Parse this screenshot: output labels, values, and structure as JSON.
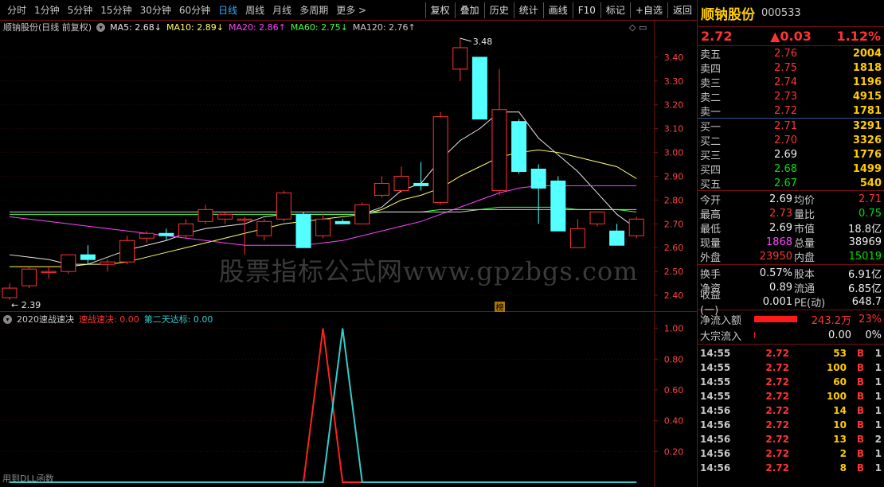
{
  "toolbar": {
    "periods": [
      "分时",
      "1分钟",
      "5分钟",
      "15分钟",
      "30分钟",
      "60分钟",
      "日线",
      "周线",
      "月线",
      "多周期",
      "更多 >"
    ],
    "active_period": "日线",
    "buttons": [
      "复权",
      "叠加",
      "历史",
      "统计",
      "画线",
      "F10",
      "标记",
      "+自选",
      "返回"
    ]
  },
  "main_chart": {
    "title": "顺钠股份(日线 前复权)",
    "ma_labels": [
      {
        "text": "MA5: 2.68↓",
        "color": "#e8e8e8"
      },
      {
        "text": "MA10: 2.89↓",
        "color": "#ffff66"
      },
      {
        "text": "MA20: 2.86↑",
        "color": "#ff44ff"
      },
      {
        "text": "MA60: 2.75↓",
        "color": "#44ff44"
      },
      {
        "text": "MA120: 2.76↑",
        "color": "#cccccc"
      }
    ],
    "high_label": "3.48",
    "low_label": "2.39",
    "marker_badge": "榜",
    "watermark": "股票指标公式网www.gpzbgs.com",
    "corner_icons": "◇ ▭"
  },
  "indicator_chart": {
    "name": "2020速战速决",
    "series_labels": [
      {
        "text": "速战速决: 0.00",
        "color": "#ff3333"
      },
      {
        "text": "第二天达标: 0.00",
        "color": "#33cccc"
      }
    ],
    "footer_note": "用到DLL函数"
  },
  "chart_data": [
    {
      "type": "candlestick",
      "title": "顺钠股份(日线 前复权)",
      "ylim": [
        2.35,
        3.52
      ],
      "y_ticks": [
        "3.40",
        "3.30",
        "3.20",
        "3.10",
        "3.00",
        "2.90",
        "2.80",
        "2.70",
        "2.60",
        "2.50",
        "2.40"
      ],
      "candles": [
        {
          "o": 2.39,
          "h": 2.45,
          "l": 2.38,
          "c": 2.43
        },
        {
          "o": 2.44,
          "h": 2.52,
          "l": 2.43,
          "c": 2.51
        },
        {
          "o": 2.5,
          "h": 2.52,
          "l": 2.47,
          "c": 2.5
        },
        {
          "o": 2.5,
          "h": 2.57,
          "l": 2.49,
          "c": 2.57
        },
        {
          "o": 2.57,
          "h": 2.61,
          "l": 2.53,
          "c": 2.55
        },
        {
          "o": 2.53,
          "h": 2.55,
          "l": 2.5,
          "c": 2.54
        },
        {
          "o": 2.54,
          "h": 2.65,
          "l": 2.53,
          "c": 2.63
        },
        {
          "o": 2.64,
          "h": 2.67,
          "l": 2.62,
          "c": 2.66
        },
        {
          "o": 2.66,
          "h": 2.68,
          "l": 2.63,
          "c": 2.65
        },
        {
          "o": 2.65,
          "h": 2.72,
          "l": 2.64,
          "c": 2.7
        },
        {
          "o": 2.71,
          "h": 2.78,
          "l": 2.7,
          "c": 2.76
        },
        {
          "o": 2.72,
          "h": 2.75,
          "l": 2.7,
          "c": 2.74
        },
        {
          "o": 2.72,
          "h": 2.73,
          "l": 2.57,
          "c": 2.72
        },
        {
          "o": 2.65,
          "h": 2.72,
          "l": 2.63,
          "c": 2.71
        },
        {
          "o": 2.72,
          "h": 2.84,
          "l": 2.71,
          "c": 2.83
        },
        {
          "o": 2.74,
          "h": 2.75,
          "l": 2.6,
          "c": 2.6
        },
        {
          "o": 2.65,
          "h": 2.74,
          "l": 2.64,
          "c": 2.72
        },
        {
          "o": 2.71,
          "h": 2.72,
          "l": 2.7,
          "c": 2.7
        },
        {
          "o": 2.7,
          "h": 2.79,
          "l": 2.7,
          "c": 2.78
        },
        {
          "o": 2.82,
          "h": 2.9,
          "l": 2.81,
          "c": 2.87
        },
        {
          "o": 2.84,
          "h": 2.94,
          "l": 2.83,
          "c": 2.9
        },
        {
          "o": 2.87,
          "h": 2.96,
          "l": 2.84,
          "c": 2.86
        },
        {
          "o": 2.79,
          "h": 3.17,
          "l": 2.78,
          "c": 3.15
        },
        {
          "o": 3.35,
          "h": 3.48,
          "l": 3.3,
          "c": 3.44
        },
        {
          "o": 3.4,
          "h": 3.4,
          "l": 3.14,
          "c": 3.14
        },
        {
          "o": 2.84,
          "h": 3.35,
          "l": 2.82,
          "c": 3.18
        },
        {
          "o": 3.13,
          "h": 3.14,
          "l": 2.91,
          "c": 2.92
        },
        {
          "o": 2.93,
          "h": 2.95,
          "l": 2.7,
          "c": 2.85
        },
        {
          "o": 2.88,
          "h": 2.9,
          "l": 2.68,
          "c": 2.67
        },
        {
          "o": 2.6,
          "h": 2.72,
          "l": 2.6,
          "c": 2.68
        },
        {
          "o": 2.7,
          "h": 2.75,
          "l": 2.69,
          "c": 2.75
        },
        {
          "o": 2.67,
          "h": 2.7,
          "l": 2.61,
          "c": 2.61
        },
        {
          "o": 2.65,
          "h": 2.73,
          "l": 2.64,
          "c": 2.72
        }
      ],
      "series": [
        {
          "name": "MA5",
          "color": "#e8e8e8",
          "values": [
            2.57,
            2.56,
            2.55,
            2.53,
            2.53,
            2.56,
            2.59,
            2.61,
            2.63,
            2.66,
            2.68,
            2.69,
            2.7,
            2.73,
            2.74,
            2.74,
            2.74,
            2.74,
            2.74,
            2.77,
            2.84,
            2.87,
            2.97,
            3.05,
            3.1,
            3.17,
            3.17,
            3.06,
            2.99,
            2.92,
            2.83,
            2.74,
            2.68
          ]
        },
        {
          "name": "MA10",
          "color": "#ffff66",
          "values": [
            2.52,
            2.52,
            2.52,
            2.52,
            2.53,
            2.53,
            2.54,
            2.56,
            2.58,
            2.6,
            2.62,
            2.64,
            2.66,
            2.68,
            2.7,
            2.71,
            2.72,
            2.73,
            2.74,
            2.76,
            2.8,
            2.82,
            2.85,
            2.9,
            2.94,
            2.98,
            3.0,
            3.01,
            3.0,
            2.98,
            2.96,
            2.94,
            2.89
          ]
        },
        {
          "name": "MA20",
          "color": "#ff44ff",
          "values": [
            2.73,
            2.72,
            2.71,
            2.7,
            2.69,
            2.68,
            2.67,
            2.66,
            2.65,
            2.64,
            2.63,
            2.62,
            2.61,
            2.61,
            2.61,
            2.61,
            2.62,
            2.63,
            2.65,
            2.67,
            2.69,
            2.71,
            2.74,
            2.77,
            2.8,
            2.83,
            2.85,
            2.86,
            2.86,
            2.86,
            2.86,
            2.86,
            2.86
          ]
        },
        {
          "name": "MA60",
          "color": "#44ff44",
          "values": [
            2.74,
            2.74,
            2.74,
            2.74,
            2.74,
            2.74,
            2.74,
            2.74,
            2.74,
            2.74,
            2.74,
            2.74,
            2.74,
            2.74,
            2.74,
            2.74,
            2.74,
            2.74,
            2.74,
            2.75,
            2.75,
            2.75,
            2.76,
            2.76,
            2.76,
            2.77,
            2.77,
            2.77,
            2.77,
            2.76,
            2.76,
            2.76,
            2.75
          ]
        },
        {
          "name": "MA120",
          "color": "#cccccc",
          "values": [
            2.75,
            2.75,
            2.75,
            2.75,
            2.75,
            2.75,
            2.75,
            2.75,
            2.75,
            2.75,
            2.75,
            2.75,
            2.75,
            2.75,
            2.75,
            2.75,
            2.75,
            2.75,
            2.75,
            2.75,
            2.75,
            2.75,
            2.75,
            2.75,
            2.76,
            2.76,
            2.76,
            2.76,
            2.76,
            2.76,
            2.76,
            2.76,
            2.76
          ]
        }
      ]
    },
    {
      "type": "line",
      "title": "2020速战速决",
      "ylim": [
        0,
        1.05
      ],
      "y_ticks": [
        "1.00",
        "0.80",
        "0.60",
        "0.40",
        "0.20"
      ],
      "series": [
        {
          "name": "速战速决",
          "color": "#ff2222",
          "values": [
            0,
            0,
            0,
            0,
            0,
            0,
            0,
            0,
            0,
            0,
            0,
            0,
            0,
            0,
            0,
            0,
            1,
            0,
            0,
            0,
            0,
            0,
            0,
            0,
            0,
            0,
            0,
            0,
            0,
            0,
            0,
            0,
            0
          ]
        },
        {
          "name": "第二天达标",
          "color": "#33cccc",
          "values": [
            0,
            0,
            0,
            0,
            0,
            0,
            0,
            0,
            0,
            0,
            0,
            0,
            0,
            0,
            0,
            0,
            0,
            1,
            0,
            0,
            0,
            0,
            0,
            0,
            0,
            0,
            0,
            0,
            0,
            0,
            0,
            0,
            0
          ]
        }
      ]
    }
  ],
  "side": {
    "name": "顺钠股份",
    "code": "000533",
    "price": "2.72",
    "change": "▲0.03",
    "pct": "1.12%",
    "asks": [
      {
        "label": "卖五",
        "price": "2.76",
        "vol": "2004",
        "pc": "red"
      },
      {
        "label": "卖四",
        "price": "2.75",
        "vol": "1818",
        "pc": "red"
      },
      {
        "label": "卖三",
        "price": "2.74",
        "vol": "1196",
        "pc": "red"
      },
      {
        "label": "卖二",
        "price": "2.73",
        "vol": "4915",
        "pc": "red"
      },
      {
        "label": "卖一",
        "price": "2.72",
        "vol": "1781",
        "pc": "red"
      }
    ],
    "bids": [
      {
        "label": "买一",
        "price": "2.71",
        "vol": "3291",
        "pc": "red"
      },
      {
        "label": "买二",
        "price": "2.70",
        "vol": "3326",
        "pc": "red"
      },
      {
        "label": "买三",
        "price": "2.69",
        "vol": "1776",
        "pc": "white"
      },
      {
        "label": "买四",
        "price": "2.68",
        "vol": "1499",
        "pc": "green"
      },
      {
        "label": "买五",
        "price": "2.67",
        "vol": "540",
        "pc": "green"
      }
    ],
    "stats1": [
      {
        "k": "今开",
        "v": "2.69",
        "vc": "white",
        "k2": "均价",
        "v2": "2.71",
        "v2c": "red"
      },
      {
        "k": "最高",
        "v": "2.73",
        "vc": "red",
        "k2": "量比",
        "v2": "0.75",
        "v2c": "green"
      },
      {
        "k": "最低",
        "v": "2.69",
        "vc": "white",
        "k2": "市值",
        "v2": "18.8亿",
        "v2c": "white"
      },
      {
        "k": "现量",
        "v": "1868",
        "vc": "magenta",
        "k2": "总量",
        "v2": "38969",
        "v2c": "white"
      },
      {
        "k": "外盘",
        "v": "23950",
        "vc": "red",
        "k2": "内盘",
        "v2": "15019",
        "v2c": "green"
      }
    ],
    "stats2": [
      {
        "k": "换手",
        "v": "0.57%",
        "vc": "white",
        "k2": "股本",
        "v2": "6.91亿",
        "v2c": "white"
      },
      {
        "k": "净资",
        "v": "0.89",
        "vc": "white",
        "k2": "流通",
        "v2": "6.85亿",
        "v2c": "white"
      },
      {
        "k": "收益(一)",
        "v": "0.001",
        "vc": "white",
        "k2": "PE(动)",
        "v2": "648.7",
        "v2c": "white"
      }
    ],
    "flow": [
      {
        "label": "净流入额",
        "value": "243.2万",
        "pct": "23%",
        "bar": 0.9
      },
      {
        "label": "大宗流入",
        "value": "0.00",
        "pct": "0%",
        "bar": 0
      }
    ],
    "trades": [
      {
        "t": "14:55",
        "p": "2.72",
        "v": "53",
        "d": "B",
        "n": "1"
      },
      {
        "t": "14:55",
        "p": "2.72",
        "v": "100",
        "d": "B",
        "n": "1"
      },
      {
        "t": "14:55",
        "p": "2.72",
        "v": "60",
        "d": "B",
        "n": "1"
      },
      {
        "t": "14:55",
        "p": "2.72",
        "v": "100",
        "d": "B",
        "n": "1"
      },
      {
        "t": "14:56",
        "p": "2.72",
        "v": "14",
        "d": "B",
        "n": "1"
      },
      {
        "t": "14:56",
        "p": "2.72",
        "v": "10",
        "d": "B",
        "n": "1"
      },
      {
        "t": "14:56",
        "p": "2.72",
        "v": "13",
        "d": "B",
        "n": "2"
      },
      {
        "t": "14:56",
        "p": "2.72",
        "v": "2",
        "d": "B",
        "n": "1"
      },
      {
        "t": "14:56",
        "p": "2.72",
        "v": "8",
        "d": "B",
        "n": "1"
      }
    ]
  }
}
